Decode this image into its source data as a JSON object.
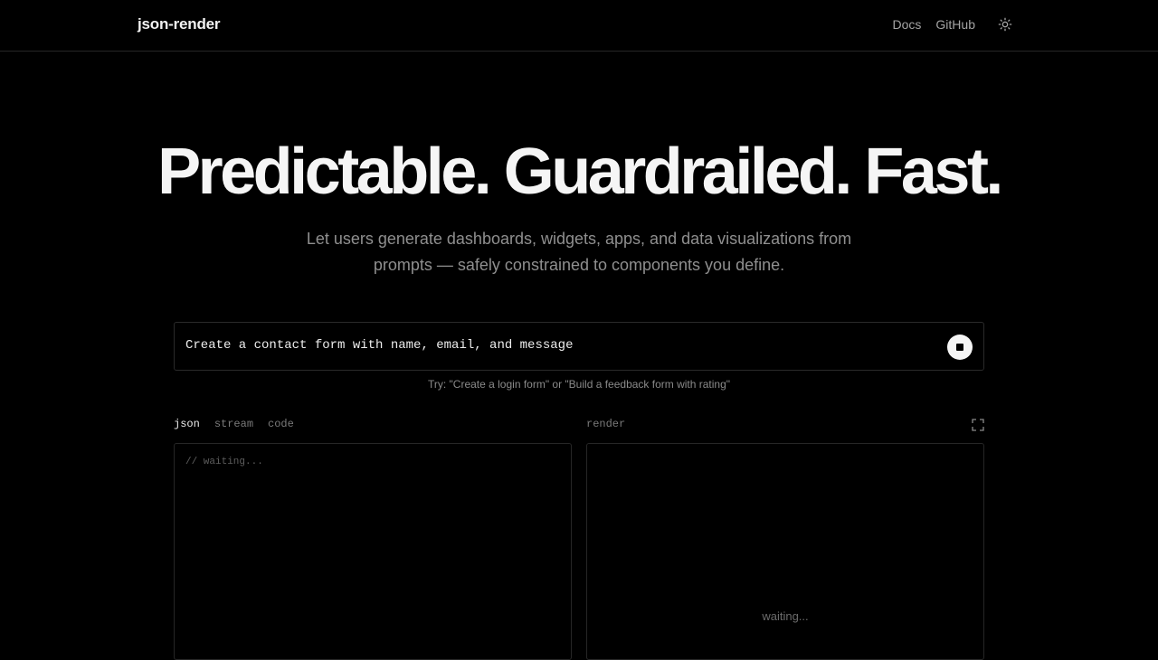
{
  "header": {
    "brand": "json-render",
    "nav": [
      "Docs",
      "GitHub"
    ],
    "theme_icon": "sun-icon"
  },
  "hero": {
    "title": "Predictable. Guardrailed. Fast.",
    "subtitle": "Let users generate dashboards, widgets, apps, and data visualizations from prompts — safely constrained to components you define."
  },
  "prompt": {
    "value": "Create a contact form with name, email, and message",
    "stop_icon": "stop-icon",
    "hint": "Try: \"Create a login form\" or \"Build a feedback form with rating\""
  },
  "editor": {
    "tabs": [
      "json",
      "stream",
      "code"
    ],
    "active_tab": "json",
    "code_placeholder": "// waiting...",
    "render_label": "render",
    "render_waiting": "waiting...",
    "expand_icon": "expand-icon"
  },
  "colors": {
    "background": "#000000",
    "text": "#ededed",
    "muted": "#8f8f8f",
    "border": "#262626"
  }
}
